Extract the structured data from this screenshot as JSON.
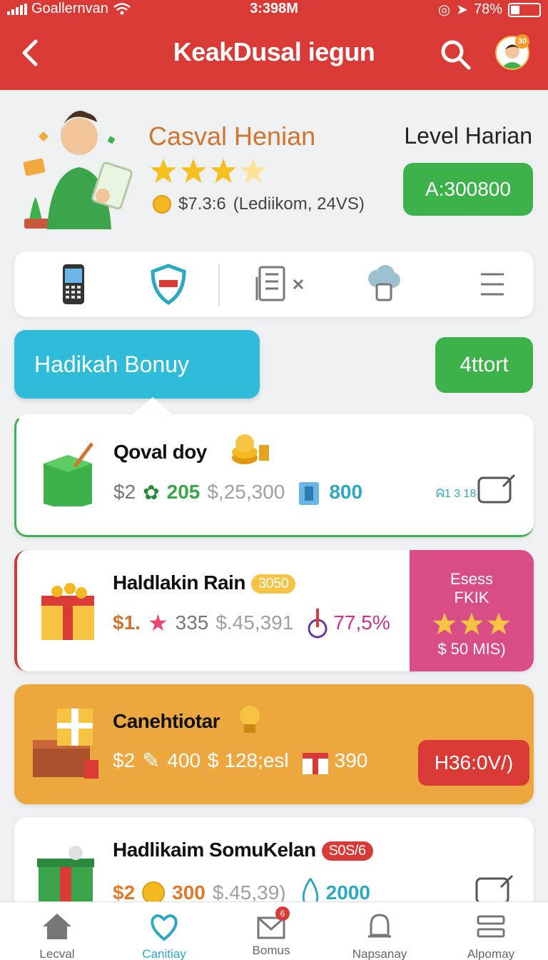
{
  "status_bar": {
    "carrier": "Goallernvan",
    "time": "3:398M",
    "battery": "78%"
  },
  "header": {
    "title": "KeakDusal iegun",
    "avatar_badge": "30"
  },
  "profile": {
    "name": "Casval Henian",
    "stars": 4,
    "coins": "$7.3:6",
    "coins_note": "(Lediikom, 24VS)",
    "level_label": "Level Harian",
    "level_value": "A:300800"
  },
  "iconbar": {
    "items": [
      "phone-icon",
      "shield-icon",
      "ledger-icon",
      "chef-hat-icon",
      "list-icon"
    ]
  },
  "sections": {
    "bonus_tab": "Hadikah Bonuy",
    "start_button": "4ttort"
  },
  "cards": [
    {
      "title": "Qoval doy",
      "price": "$2",
      "value1": "205",
      "value2": "$,25,300",
      "value3": "800",
      "tag": "ᕱ1 3 18"
    },
    {
      "title": "Haldlakin Rain",
      "badge": "3050",
      "price": "$1.",
      "value1": "335",
      "value2": "$.45,391",
      "percent": "77,5%",
      "panel": {
        "line1": "Esess",
        "line2": "FKIK",
        "line3": "$ 50 MIS)"
      }
    },
    {
      "title": "Canehtiotar",
      "price": "$2",
      "value1": "400",
      "value2": "$ 128;esl",
      "value3": "390",
      "button": "H36:0V/)"
    },
    {
      "title": "Hadlikaim SomuKelan",
      "badge": "S0S/6",
      "price": "$2",
      "value1": "300",
      "value2": "$.45,39)",
      "value3": "2000"
    }
  ],
  "bottom_nav": [
    {
      "label": "Lecval",
      "icon": "home-icon"
    },
    {
      "label": "Canitiay",
      "icon": "heart-icon"
    },
    {
      "label": "Bomus",
      "icon": "mail-icon",
      "badge": "6"
    },
    {
      "label": "Napsanay",
      "icon": "bell-icon"
    },
    {
      "label": "Alpomay",
      "icon": "settings-icon"
    }
  ],
  "colors": {
    "primary_red": "#d93a36",
    "green": "#3db24b",
    "blue": "#2ebcd9",
    "pink": "#d94d86",
    "orange": "#eda73f"
  }
}
